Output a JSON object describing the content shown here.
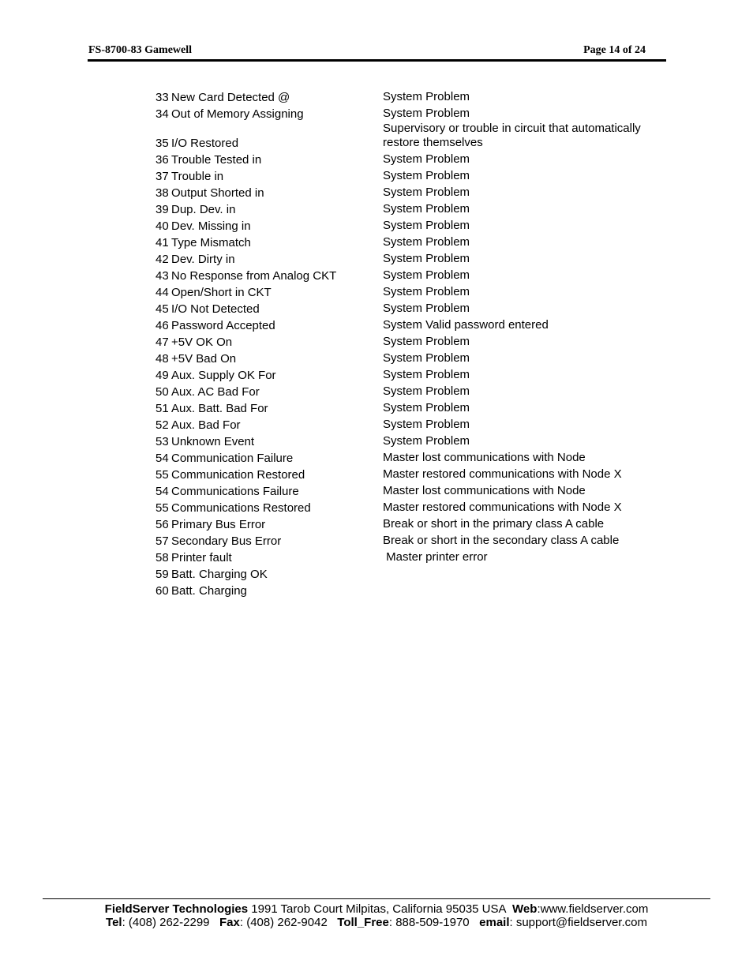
{
  "header": {
    "doc_title": "FS-8700-83 Gamewell",
    "page_label": "Page 14 of 24"
  },
  "events": [
    {
      "num": "33",
      "name": "New Card Detected @",
      "desc": "System Problem"
    },
    {
      "num": "34",
      "name": "Out of Memory Assigning",
      "desc": "System Problem"
    },
    {
      "num": "35",
      "name": "I/O Restored",
      "desc": "Supervisory or trouble in circuit that automatically restore themselves",
      "desc_line1": "Supervisory or trouble in circuit that automatically",
      "desc_line2": "restore themselves"
    },
    {
      "num": "36",
      "name": "Trouble Tested in",
      "desc": "System Problem"
    },
    {
      "num": "37",
      "name": "Trouble in",
      "desc": "System Problem"
    },
    {
      "num": "38",
      "name": "Output Shorted in",
      "desc": "System Problem"
    },
    {
      "num": "39",
      "name": "Dup. Dev. in",
      "desc": "System Problem"
    },
    {
      "num": "40",
      "name": "Dev. Missing in",
      "desc": "System Problem"
    },
    {
      "num": "41",
      "name": "Type Mismatch",
      "desc": "System Problem"
    },
    {
      "num": "42",
      "name": "Dev. Dirty in",
      "desc": "System Problem"
    },
    {
      "num": "43",
      "name": "No Response from Analog CKT",
      "desc": "System Problem"
    },
    {
      "num": "44",
      "name": "Open/Short in CKT",
      "desc": "System Problem"
    },
    {
      "num": "45",
      "name": "I/O Not Detected",
      "desc": "System Problem"
    },
    {
      "num": "46",
      "name": "Password Accepted",
      "desc": "System Valid password entered"
    },
    {
      "num": "47",
      "name": "+5V OK On",
      "desc": "System Problem"
    },
    {
      "num": "48",
      "name": "+5V Bad On",
      "desc": "System Problem"
    },
    {
      "num": "49",
      "name": "Aux. Supply OK For",
      "desc": "System Problem"
    },
    {
      "num": "50",
      "name": "Aux. AC Bad For",
      "desc": "System Problem"
    },
    {
      "num": "51",
      "name": "Aux. Batt. Bad For",
      "desc": "System Problem"
    },
    {
      "num": "52",
      "name": "Aux. Bad For",
      "desc": "System Problem"
    },
    {
      "num": "53",
      "name": "Unknown Event",
      "desc": "System Problem"
    },
    {
      "num": "54",
      "name": "Communication Failure",
      "desc": "Master lost communications with Node"
    },
    {
      "num": "55",
      "name": "Communication Restored",
      "desc": "Master restored communications with Node X"
    },
    {
      "num": "54",
      "name": "Communications Failure",
      "desc": "Master lost communications with Node"
    },
    {
      "num": "55",
      "name": "Communications Restored",
      "desc": "Master restored communications with Node X"
    },
    {
      "num": "56",
      "name": "Primary Bus Error",
      "desc": "Break or short in the primary class A cable"
    },
    {
      "num": "57",
      "name": "Secondary Bus Error",
      "desc": "Break or short in the secondary class A cable"
    },
    {
      "num": "58",
      "name": "Printer fault",
      "desc": " Master printer error"
    },
    {
      "num": "59",
      "name": "Batt. Charging OK",
      "desc": ""
    },
    {
      "num": "60",
      "name": "Batt. Charging",
      "desc": ""
    }
  ],
  "footer": {
    "company": "FieldServer Technologies",
    "address": " 1991 Tarob Court Milpitas, California 95035 USA  ",
    "web_label": "Web",
    "web_value": ":www.fieldserver.com",
    "tel_label": "Tel",
    "tel_value": ": (408) 262-2299   ",
    "fax_label": "Fax",
    "fax_value": ": (408) 262-9042   ",
    "tollfree_label": "Toll_Free",
    "tollfree_value": ": 888-509-1970   ",
    "email_label": "email",
    "email_value": ": support@fieldserver.com"
  }
}
